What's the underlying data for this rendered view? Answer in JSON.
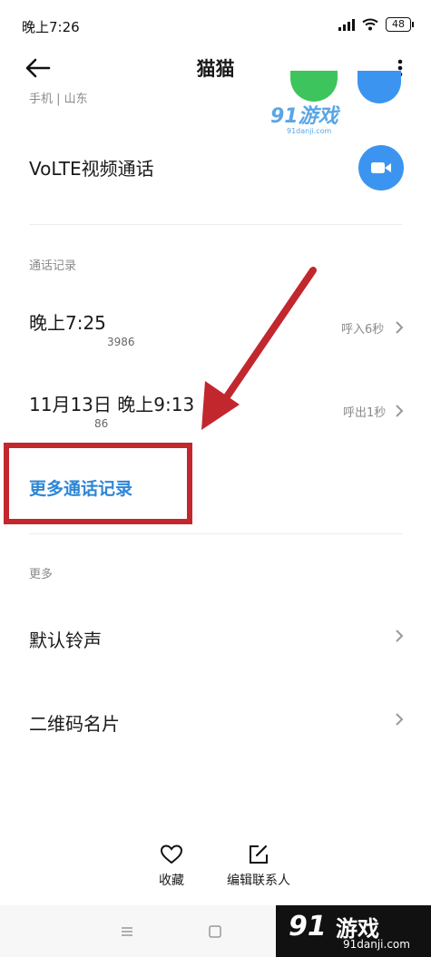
{
  "status_bar": {
    "time": "晚上7:26",
    "battery": "48"
  },
  "header": {
    "title": "猫猫"
  },
  "contact": {
    "sub_info": "手机 | 山东"
  },
  "watermark": {
    "top_logo": "91游戏",
    "top_url": "91danji.com",
    "footer_logo": "91",
    "footer_text": "游戏",
    "footer_url": "91danji.com"
  },
  "volte": {
    "label": "VoLTE视频通话"
  },
  "call_log": {
    "header": "通话记录",
    "entries": [
      {
        "time": "晚上7:25",
        "number": "3986",
        "status": "呼入6秒"
      },
      {
        "time": "11月13日 晚上9:13",
        "number": "86",
        "status": "呼出1秒"
      }
    ],
    "more_label": "更多通话记录"
  },
  "more_section": {
    "header": "更多",
    "items": [
      {
        "label": "默认铃声"
      },
      {
        "label": "二维码名片"
      }
    ]
  },
  "bottom_actions": {
    "favorite": "收藏",
    "edit": "编辑联系人"
  },
  "colors": {
    "accent_blue": "#3b95f0",
    "link_blue": "#2e86d6",
    "annotation_red": "#c1272d",
    "green": "#3ec45c"
  },
  "icons": {
    "back": "arrow-left-icon",
    "more": "more-vertical-icon",
    "video": "video-camera-icon",
    "favorite": "heart-icon",
    "edit": "edit-icon",
    "chevron": "chevron-right-icon"
  }
}
